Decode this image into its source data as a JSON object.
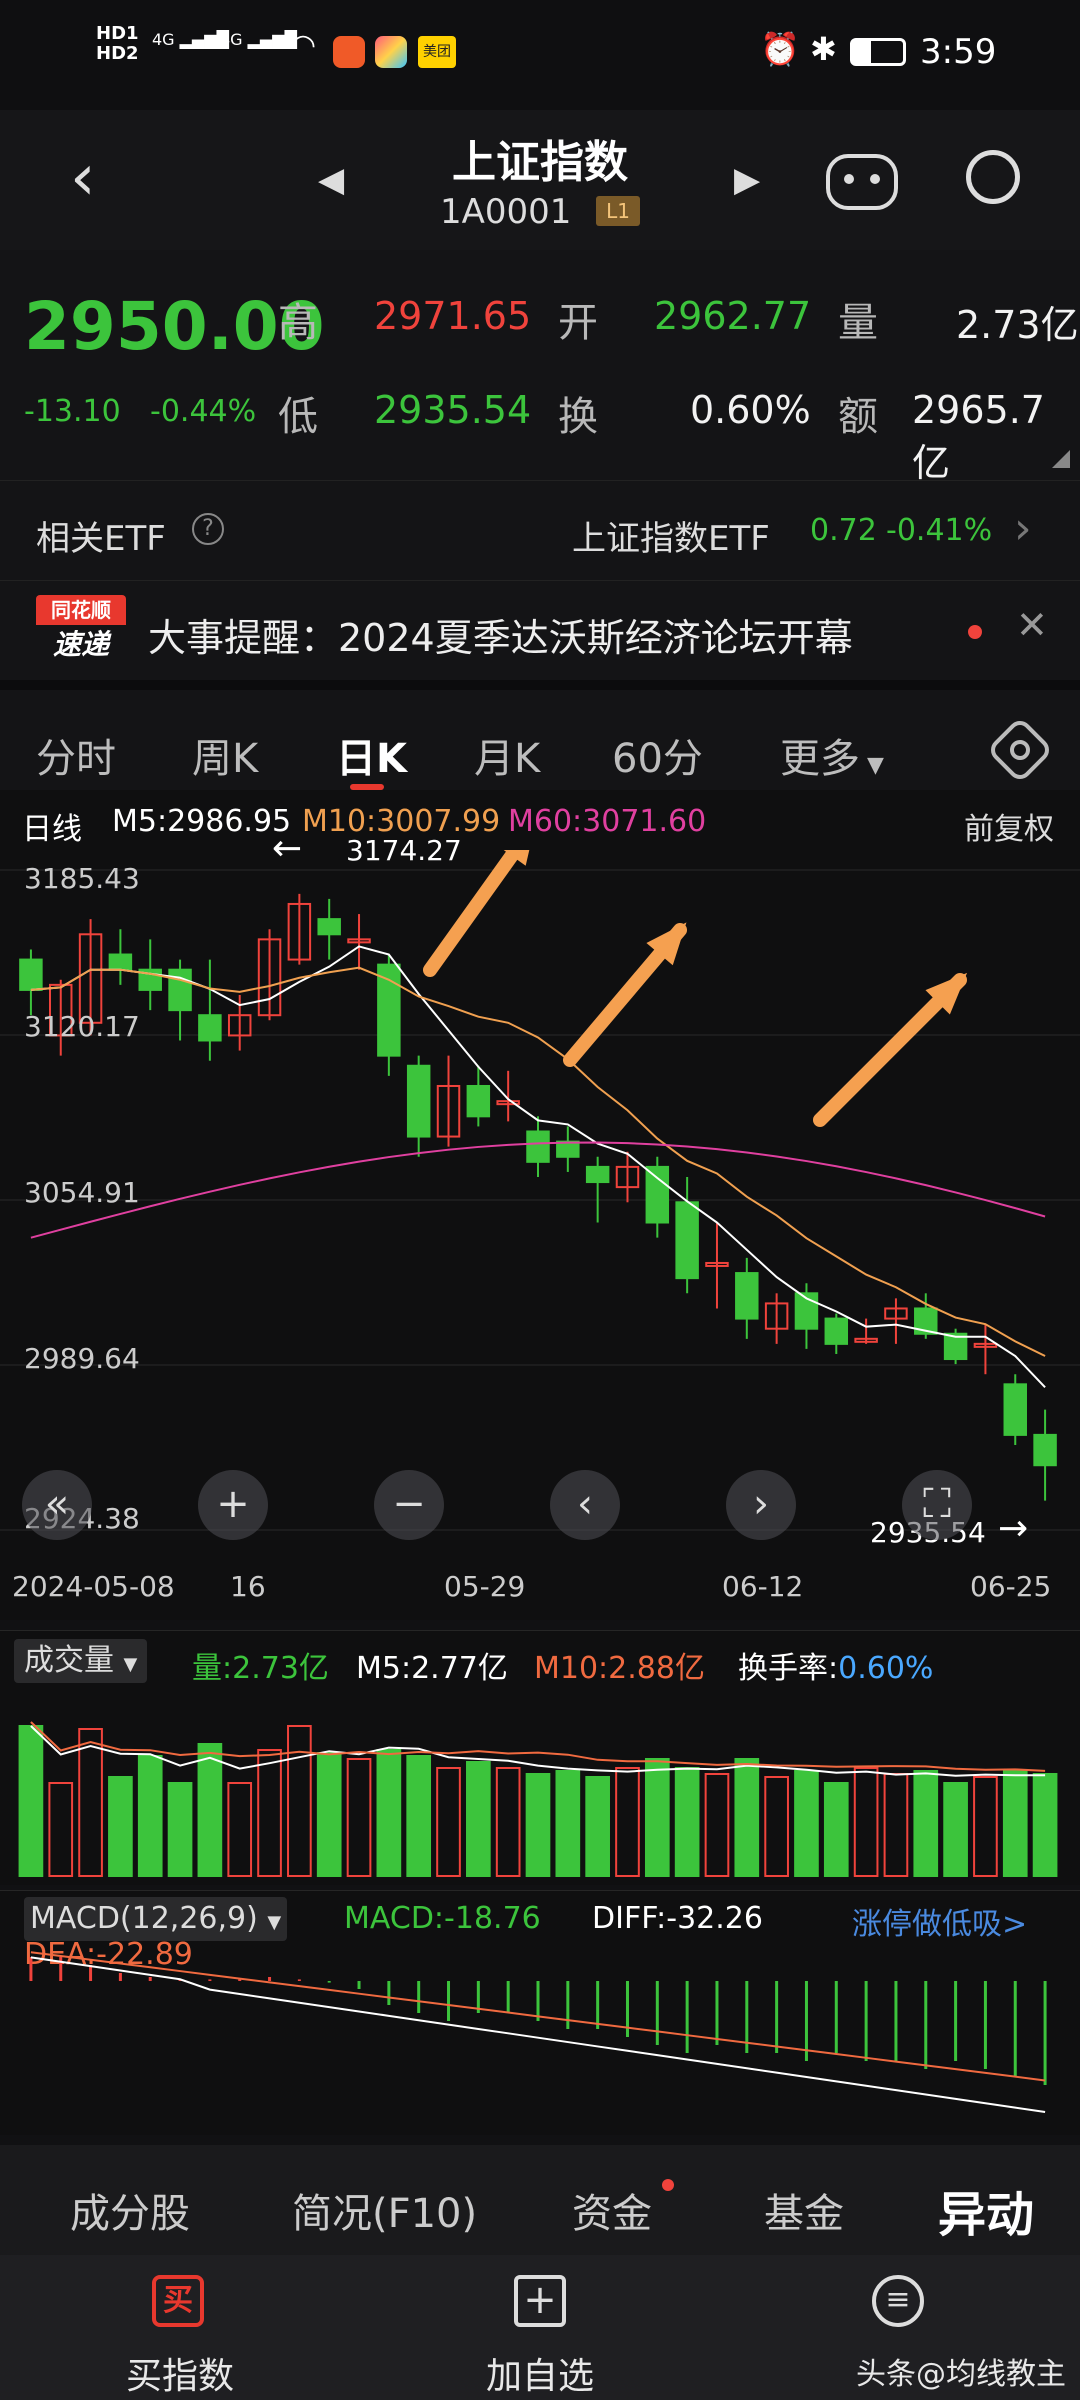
{
  "status": {
    "hd1": "HD1",
    "hd2": "HD2",
    "net1": "4G",
    "net2": "4G",
    "app3": "美团",
    "time": "3:59"
  },
  "header": {
    "title": "上证指数",
    "code": "1A0001",
    "level": "L1"
  },
  "quote": {
    "price": "2950.00",
    "change": "-13.10",
    "change_pct": "-0.44%",
    "high_label": "高",
    "high": "2971.65",
    "open_label": "开",
    "open": "2962.77",
    "vol_label": "量",
    "vol": "2.73亿",
    "low_label": "低",
    "low": "2935.54",
    "turn_label": "换",
    "turn": "0.60%",
    "amt_label": "额",
    "amt": "2965.7亿"
  },
  "etf": {
    "label": "相关ETF",
    "name": "上证指数ETF",
    "price": "0.72",
    "pct": "-0.41%"
  },
  "news": {
    "badge_top": "同花顺",
    "badge_bottom": "速递",
    "text": "大事提醒：2024夏季达沃斯经济论坛开幕"
  },
  "tabs": [
    "分时",
    "周K",
    "日K",
    "月K",
    "60分",
    "更多"
  ],
  "kline": {
    "period": "日线",
    "m5": "M5:2986.95",
    "m10": "M10:3007.99",
    "m60": "M60:3071.60",
    "adjust": "前复权",
    "y_labels": [
      "3185.43",
      "3120.17",
      "3054.91",
      "2989.64",
      "2924.38"
    ],
    "high_mark": "3174.27",
    "low_mark": "2935.54",
    "x_labels": [
      "2024-05-08",
      "16",
      "05-29",
      "06-12",
      "06-25"
    ]
  },
  "volume": {
    "selector": "成交量",
    "vol": "量:2.73亿",
    "m5": "M5:2.77亿",
    "m10": "M10:2.88亿",
    "turn_label": "换手率:",
    "turn": "0.60%"
  },
  "macd": {
    "selector": "MACD(12,26,9)",
    "macd": "MACD:-18.76",
    "diff": "DIFF:-32.26",
    "link": "涨停做低吸>",
    "dea": "DEA:-22.89"
  },
  "subtabs": [
    "成分股",
    "简况(F10)",
    "资金",
    "基金",
    "异动"
  ],
  "bottomnav": {
    "buy": "买指数",
    "add": "加自选",
    "watermark": "头条@均线教主",
    "buy_icon": "买"
  },
  "colors": {
    "up": "#f0433c",
    "down": "#3cc43c",
    "m5": "#ffffff",
    "m10": "#f0a050",
    "m60": "#e040a0",
    "arrow": "#f5a050"
  },
  "chart_data": {
    "type": "candlestick",
    "y_range": [
      2924.38,
      3185.43
    ],
    "candles": [
      [
        3150,
        3138,
        3154,
        3128
      ],
      [
        3120,
        3140,
        3142,
        3112
      ],
      [
        3125,
        3160,
        3166,
        3120
      ],
      [
        3152,
        3146,
        3162,
        3140
      ],
      [
        3146,
        3138,
        3158,
        3130
      ],
      [
        3146,
        3130,
        3150,
        3118
      ],
      [
        3128,
        3118,
        3150,
        3110
      ],
      [
        3120,
        3128,
        3136,
        3114
      ],
      [
        3128,
        3158,
        3162,
        3126
      ],
      [
        3150,
        3172,
        3176,
        3148
      ],
      [
        3166,
        3160,
        3174,
        3150
      ],
      [
        3158,
        3158,
        3168,
        3146
      ],
      [
        3148,
        3112,
        3152,
        3104
      ],
      [
        3108,
        3080,
        3112,
        3072
      ],
      [
        3080,
        3100,
        3112,
        3076
      ],
      [
        3100,
        3088,
        3108,
        3084
      ],
      [
        3094,
        3094,
        3106,
        3086
      ],
      [
        3082,
        3070,
        3088,
        3064
      ],
      [
        3078,
        3072,
        3084,
        3066
      ],
      [
        3068,
        3062,
        3072,
        3046
      ],
      [
        3060,
        3068,
        3074,
        3054
      ],
      [
        3068,
        3046,
        3072,
        3040
      ],
      [
        3054,
        3024,
        3064,
        3018
      ],
      [
        3030,
        3030,
        3046,
        3012
      ],
      [
        3026,
        3008,
        3032,
        3000
      ],
      [
        3004,
        3014,
        3018,
        2998
      ],
      [
        3018,
        3004,
        3022,
        2996
      ],
      [
        3008,
        2998,
        3010,
        2994
      ],
      [
        3000,
        3000,
        3008,
        2998
      ],
      [
        3008,
        3012,
        3016,
        2998
      ],
      [
        3012,
        3002,
        3018,
        3000
      ],
      [
        3002,
        2992,
        3004,
        2990
      ],
      [
        2998,
        2998,
        3006,
        2986
      ],
      [
        2982,
        2962,
        2986,
        2958
      ],
      [
        2962,
        2950,
        2972,
        2936
      ]
    ],
    "volume": [
      1.0,
      0.62,
      0.98,
      0.66,
      0.8,
      0.62,
      0.88,
      0.62,
      0.84,
      1.0,
      0.82,
      0.78,
      0.84,
      0.8,
      0.72,
      0.76,
      0.72,
      0.68,
      0.7,
      0.66,
      0.72,
      0.78,
      0.72,
      0.68,
      0.78,
      0.66,
      0.7,
      0.62,
      0.72,
      0.68,
      0.7,
      0.62,
      0.66,
      0.7,
      0.68
    ],
    "macd": [
      3,
      3,
      2,
      1,
      0.5,
      0.2,
      0.2,
      0.2,
      0.5,
      0.2,
      -0.2,
      -1,
      -3,
      -4,
      -5,
      -4,
      -4,
      -5,
      -6,
      -6,
      -7,
      -8,
      -9,
      -8,
      -9,
      -9,
      -10,
      -9,
      -10,
      -10,
      -11,
      -10,
      -11,
      -12,
      -13
    ]
  }
}
